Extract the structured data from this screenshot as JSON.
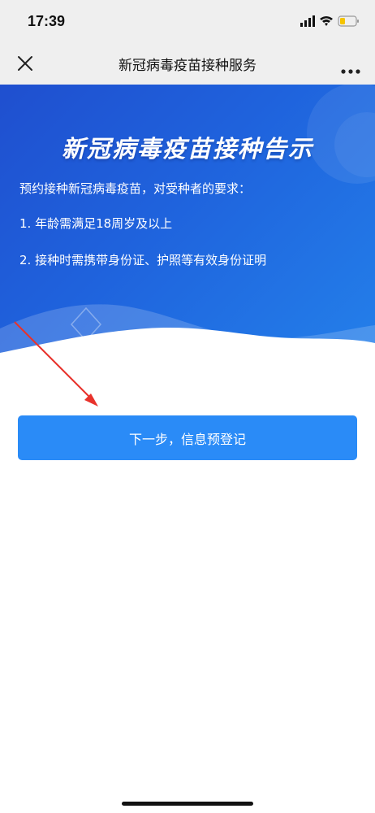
{
  "status_bar": {
    "time": "17:39"
  },
  "nav": {
    "title": "新冠病毒疫苗接种服务"
  },
  "banner": {
    "title": "新冠病毒疫苗接种告示",
    "intro": "预约接种新冠病毒疫苗，对受种者的要求：",
    "requirements": [
      "1. 年龄需满足18周岁及以上",
      "2. 接种时需携带身份证、护照等有效身份证明"
    ]
  },
  "next_button": {
    "label": "下一步，信息预登记"
  },
  "colors": {
    "banner_start": "#1f4fcf",
    "banner_end": "#2480ea",
    "button": "#2a8bf7",
    "annotation_arrow": "#e8322b"
  }
}
